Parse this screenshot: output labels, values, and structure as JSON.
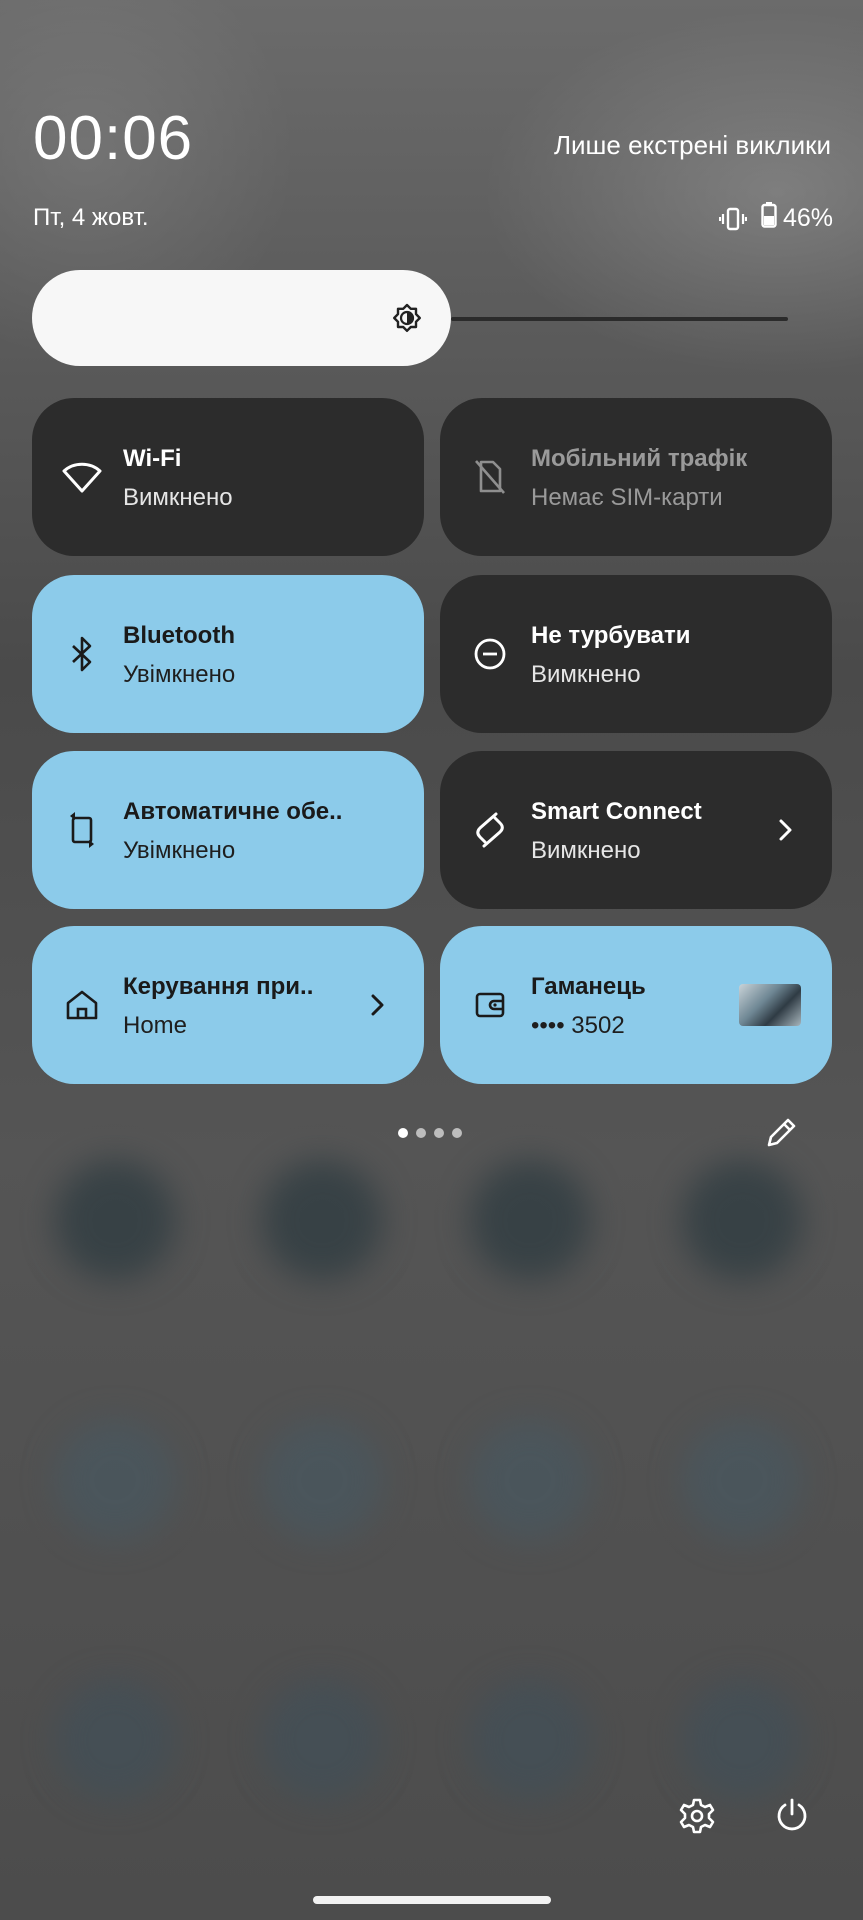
{
  "status_bar": {
    "time": "00:06",
    "date": "Пт, 4 жовт.",
    "network_status": "Лише екстрені виклики",
    "battery": "46%",
    "vibrate_icon": "vibrate-icon",
    "battery_icon": "battery-icon"
  },
  "brightness": {
    "icon": "brightness-icon",
    "level_percent": 43
  },
  "tiles": [
    {
      "title": "Wi-Fi",
      "subtitle": "Вимкнено",
      "icon": "wifi-icon",
      "state": "off"
    },
    {
      "title": "Мобільний  трафік",
      "subtitle": "Немає SIM-карти",
      "icon": "no-sim-icon",
      "state": "unavailable"
    },
    {
      "title": "Bluetooth",
      "subtitle": "Увімкнено",
      "icon": "bluetooth-icon",
      "state": "on"
    },
    {
      "title": "Не турбувати",
      "subtitle": "Вимкнено",
      "icon": "do-not-disturb-icon",
      "state": "off"
    },
    {
      "title": "Автоматичне обе..",
      "subtitle": "Увімкнено",
      "icon": "auto-rotate-icon",
      "state": "on"
    },
    {
      "title": "Smart Connect",
      "subtitle": "Вимкнено",
      "icon": "smart-connect-icon",
      "state": "off"
    },
    {
      "title": "Керування при..",
      "subtitle": "Home",
      "icon": "home-icon",
      "state": "on"
    },
    {
      "title": "Гаманець",
      "subtitle": "•••• 3502",
      "icon": "wallet-icon",
      "state": "on"
    }
  ],
  "pager": {
    "pages": 4,
    "current": 1
  },
  "bottom_actions": {
    "edit_icon": "edit-pencil-icon",
    "settings_icon": "settings-gear-icon",
    "power_icon": "power-icon"
  },
  "colors": {
    "tile_on": "#8ccbea",
    "tile_off": "#2c2c2c",
    "brightness_fill": "#f7f7f7"
  }
}
